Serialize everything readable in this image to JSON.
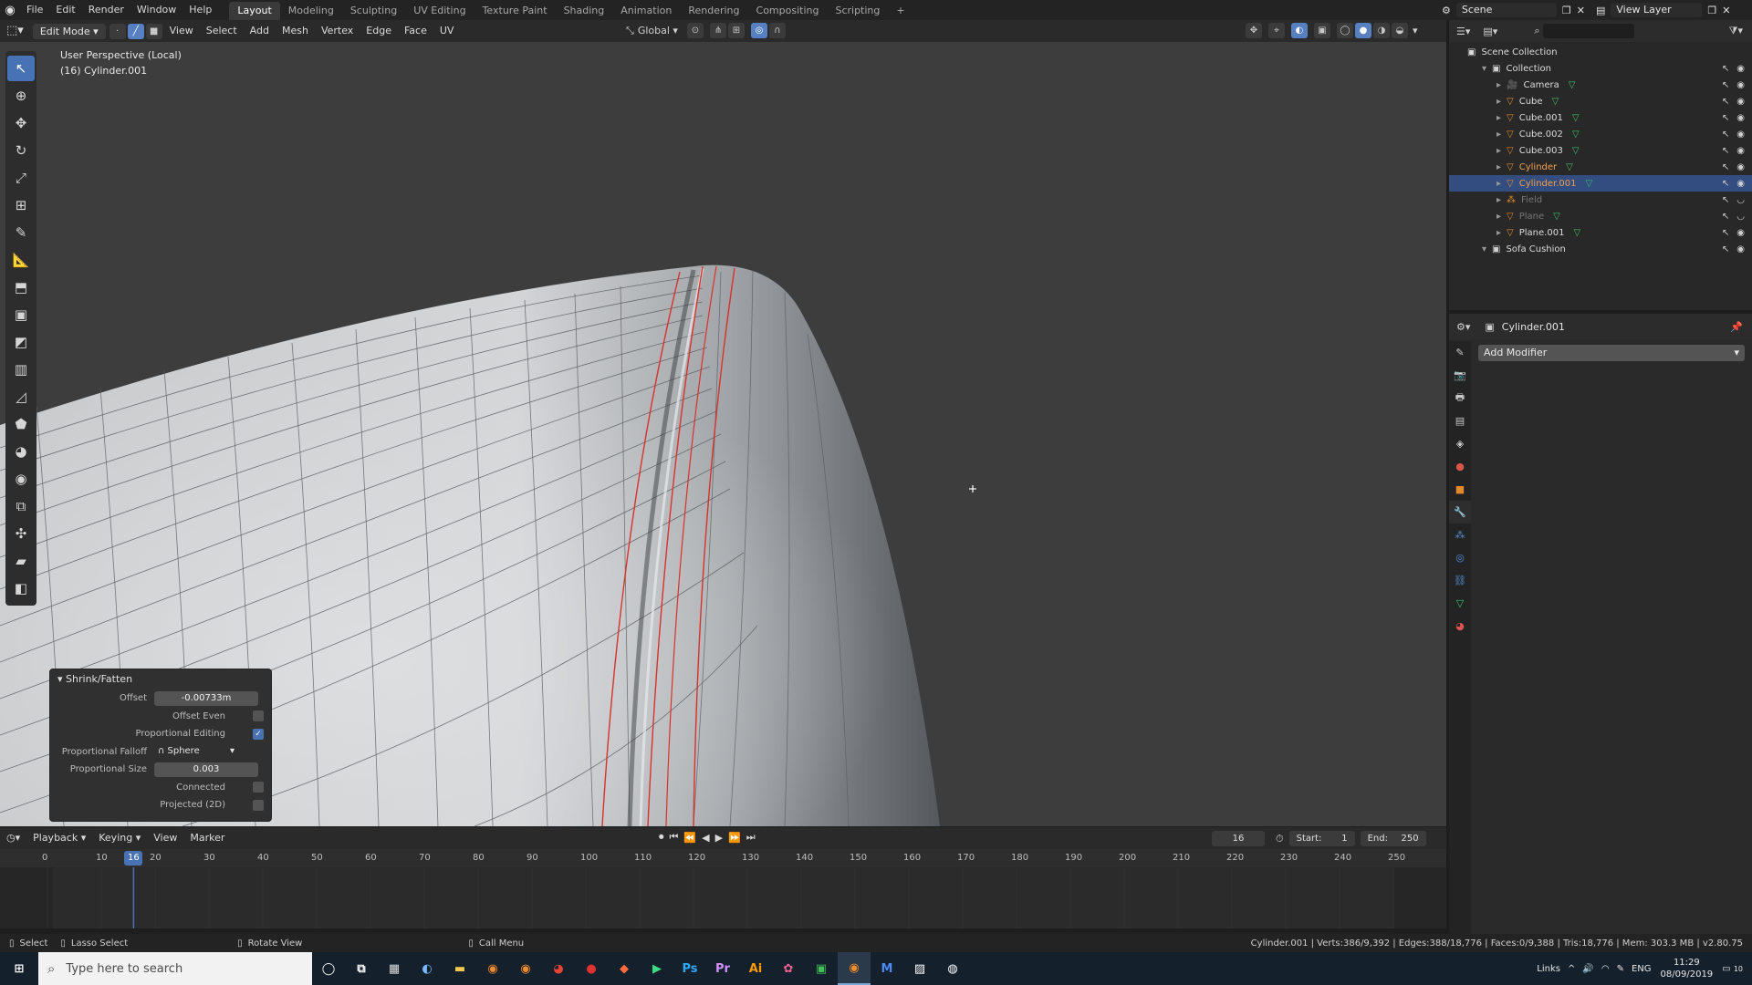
{
  "app": {
    "top_menu": [
      "File",
      "Edit",
      "Render",
      "Window",
      "Help"
    ],
    "workspaces": [
      "Layout",
      "Modeling",
      "Sculpting",
      "UV Editing",
      "Texture Paint",
      "Shading",
      "Animation",
      "Rendering",
      "Compositing",
      "Scripting"
    ],
    "active_workspace": "Layout",
    "scene": "Scene",
    "view_layer": "View Layer"
  },
  "viewport_header": {
    "mode": "Edit Mode",
    "menus": [
      "View",
      "Select",
      "Add",
      "Mesh",
      "Vertex",
      "Edge",
      "Face",
      "UV"
    ],
    "orientation": "Global"
  },
  "viewport": {
    "perspective_label": "User Perspective (Local)",
    "object_label": "(16) Cylinder.001"
  },
  "operator_panel": {
    "title": "Shrink/Fatten",
    "offset_label": "Offset",
    "offset_value": "-0.00733m",
    "offset_even_label": "Offset Even",
    "offset_even": false,
    "prop_editing_label": "Proportional Editing",
    "prop_editing": true,
    "falloff_label": "Proportional Falloff",
    "falloff_value": "Sphere",
    "size_label": "Proportional Size",
    "size_value": "0.003",
    "connected_label": "Connected",
    "connected": false,
    "projected_label": "Projected (2D)",
    "projected": false
  },
  "outliner": {
    "root": "Scene Collection",
    "items": [
      {
        "name": "Collection",
        "icon": "collection-icon",
        "state": "normal"
      },
      {
        "name": "Camera",
        "icon": "camera-icon",
        "state": "normal"
      },
      {
        "name": "Cube",
        "icon": "mesh-icon",
        "state": "normal"
      },
      {
        "name": "Cube.001",
        "icon": "mesh-icon",
        "state": "normal"
      },
      {
        "name": "Cube.002",
        "icon": "mesh-icon",
        "state": "normal"
      },
      {
        "name": "Cube.003",
        "icon": "mesh-icon",
        "state": "normal"
      },
      {
        "name": "Cylinder",
        "icon": "mesh-icon",
        "state": "selected"
      },
      {
        "name": "Cylinder.001",
        "icon": "mesh-icon",
        "state": "active"
      },
      {
        "name": "Field",
        "icon": "field-icon",
        "state": "hidden"
      },
      {
        "name": "Plane",
        "icon": "mesh-icon",
        "state": "hidden"
      },
      {
        "name": "Plane.001",
        "icon": "mesh-icon",
        "state": "normal"
      },
      {
        "name": "Sofa Cushion",
        "icon": "collection-icon",
        "state": "normal"
      }
    ]
  },
  "properties": {
    "object_name": "Cylinder.001",
    "add_modifier_label": "Add Modifier"
  },
  "timeline": {
    "menus": [
      "Playback",
      "Keying",
      "View",
      "Marker"
    ],
    "current_frame": "16",
    "start_label": "Start:",
    "start": "1",
    "end_label": "End:",
    "end": "250",
    "ruler": [
      "0",
      "10",
      "20",
      "30",
      "40",
      "50",
      "60",
      "70",
      "80",
      "90",
      "100",
      "110",
      "120",
      "130",
      "140",
      "150",
      "160",
      "170",
      "180",
      "190",
      "200",
      "210",
      "220",
      "230",
      "240",
      "250"
    ]
  },
  "statusbar": {
    "select": "Select",
    "lasso": "Lasso Select",
    "rotate": "Rotate View",
    "call_menu": "Call Menu",
    "stats": "Cylinder.001 | Verts:386/9,392 | Edges:388/18,776 | Faces:0/9,388 | Tris:18,776 | Mem: 303.3 MB | v2.80.75"
  },
  "taskbar": {
    "search_placeholder": "Type here to search",
    "apps": [
      "Ps",
      "Pr",
      "Ai"
    ],
    "links": "Links",
    "lang": "ENG",
    "time": "11:29",
    "date": "08/09/2019",
    "notif": "10"
  },
  "colors": {
    "accent": "#4772b3",
    "selected_text": "#f2a14a",
    "seam_red": "#d8322a",
    "mesh_grey": "#c4c6c8"
  }
}
